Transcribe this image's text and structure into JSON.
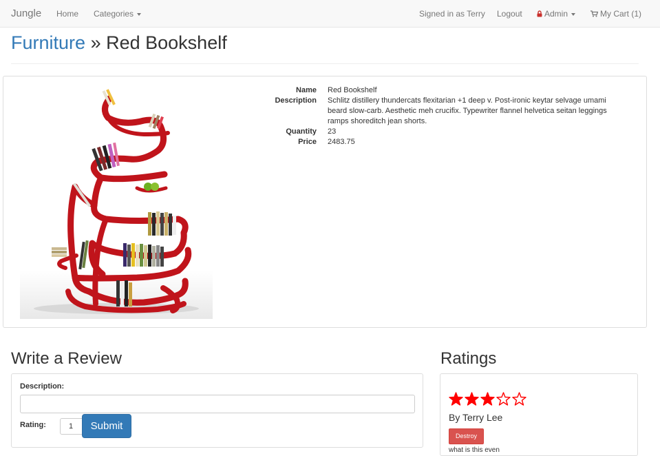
{
  "navbar": {
    "brand": "Jungle",
    "home": "Home",
    "categories": "Categories",
    "signed_in": "Signed in as Terry",
    "logout": "Logout",
    "admin": "Admin",
    "cart": "My Cart (1)",
    "accent_color": "#c9302c"
  },
  "breadcrumb": {
    "category": "Furniture",
    "separator": "»",
    "product": "Red Bookshelf"
  },
  "product": {
    "image_alt": "Red Bookshelf",
    "labels": {
      "name": "Name",
      "description": "Description",
      "quantity": "Quantity",
      "price": "Price"
    },
    "name": "Red Bookshelf",
    "description": "Schlitz distillery thundercats flexitarian +1 deep v. Post-ironic keytar selvage umami beard slow-carb. Aesthetic meh crucifix. Typewriter flannel helvetica seitan leggings ramps shoreditch jean shorts.",
    "quantity": "23",
    "price": "2483.75"
  },
  "review_form": {
    "heading": "Write a Review",
    "description_label": "Description:",
    "description_value": "",
    "rating_label": "Rating:",
    "rating_value": "1",
    "submit_label": "Submit"
  },
  "ratings": {
    "heading": "Ratings",
    "reviews": [
      {
        "stars": 3,
        "max_stars": 5,
        "star_color": "#ff0000",
        "author": "By Terry Lee",
        "destroy_label": "Destroy",
        "text": "what is this even"
      }
    ]
  }
}
